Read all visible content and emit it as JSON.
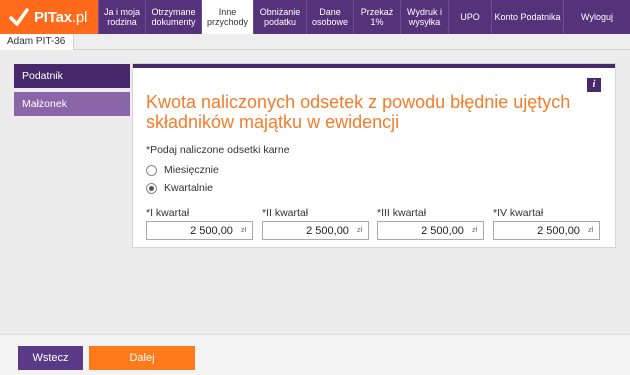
{
  "logo": {
    "brand": "PITax",
    "suffix": ".pl"
  },
  "nav": {
    "items": [
      {
        "label": "Ja i moja rodzina",
        "active": false
      },
      {
        "label": "Otrzymane dokumenty",
        "active": false
      },
      {
        "label": "Inne przychody",
        "active": true
      },
      {
        "label": "Obniżanie podatku",
        "active": false
      },
      {
        "label": "Dane osobowe",
        "active": false
      },
      {
        "label": "Przekaż 1%",
        "active": false
      },
      {
        "label": "Wydruk i wysyłka",
        "active": false
      },
      {
        "label": "UPO",
        "active": false
      },
      {
        "label": "Konto Podatnika",
        "active": false
      },
      {
        "label": "Wyloguj",
        "active": false
      }
    ]
  },
  "subbar": {
    "tab": "Adam PIT-36"
  },
  "sidebar": {
    "podatnik": "Podatnik",
    "malzonek": "Małżonek"
  },
  "main": {
    "info": "i",
    "title": "Kwota naliczonych odsetek z powodu błędnie ujętych składników majątku w ewidencji",
    "question": "Podaj naliczone odsetki karne",
    "required_mark": "*",
    "options": [
      {
        "label": "Miesięcznie",
        "checked": false
      },
      {
        "label": "Kwartalnie",
        "checked": true
      }
    ],
    "fields": [
      {
        "label": "I kwartał",
        "value": "2 500,00",
        "unit": "zł"
      },
      {
        "label": "II kwartał",
        "value": "2 500,00",
        "unit": "zł"
      },
      {
        "label": "III kwartał",
        "value": "2 500,00",
        "unit": "zł"
      },
      {
        "label": "IV kwartał",
        "value": "2 500,00",
        "unit": "zł"
      }
    ]
  },
  "footer": {
    "back": "Wstecz",
    "next": "Dalej"
  },
  "colors": {
    "accent": "#ff6b1a",
    "brand": "#56327a",
    "title": "#f57c2b"
  }
}
